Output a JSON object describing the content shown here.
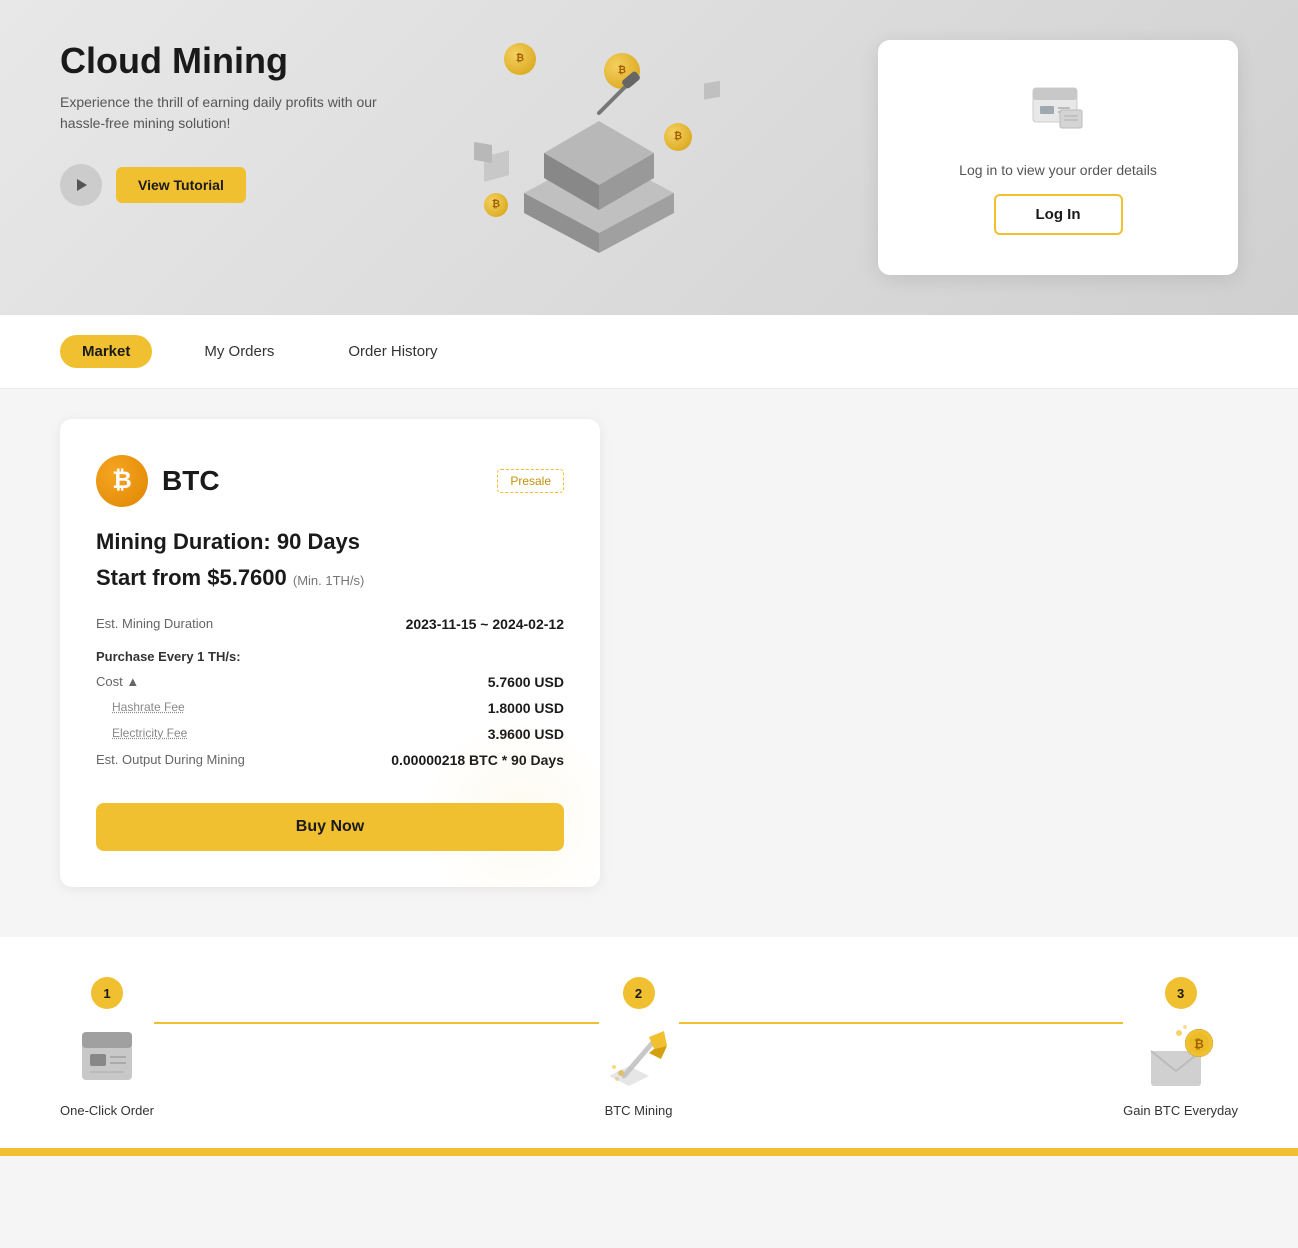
{
  "hero": {
    "title": "Cloud Mining",
    "subtitle": "Experience the thrill of earning daily profits with our hassle-free mining solution!",
    "tutorial_button": "View Tutorial",
    "login_card": {
      "text": "Log in to view your order details",
      "button": "Log In"
    }
  },
  "nav": {
    "tabs": [
      {
        "id": "market",
        "label": "Market",
        "active": true
      },
      {
        "id": "my-orders",
        "label": "My Orders",
        "active": false
      },
      {
        "id": "order-history",
        "label": "Order History",
        "active": false
      }
    ]
  },
  "mining_card": {
    "coin": "BTC",
    "badge": "Presale",
    "duration_label": "Mining Duration: 90 Days",
    "start_price_label": "Start from $5.7600",
    "min_label": "(Min. 1TH/s)",
    "details": {
      "est_duration_label": "Est. Mining Duration",
      "est_duration_value": "2023-11-15 ~ 2024-02-12",
      "purchase_label": "Purchase Every 1 TH/s:",
      "cost_label": "Cost ▲",
      "cost_value": "5.7600 USD",
      "hashrate_fee_label": "Hashrate Fee",
      "hashrate_fee_value": "1.8000 USD",
      "electricity_fee_label": "Electricity Fee",
      "electricity_fee_value": "3.9600 USD",
      "est_output_label": "Est. Output During Mining",
      "est_output_value": "0.00000218 BTC * 90 Days"
    },
    "buy_button": "Buy Now"
  },
  "steps": [
    {
      "number": "1",
      "label": "One-Click Order",
      "icon": "order-icon"
    },
    {
      "number": "2",
      "label": "BTC Mining",
      "icon": "mining-icon"
    },
    {
      "number": "3",
      "label": "Gain BTC Everyday",
      "icon": "gain-icon"
    }
  ]
}
